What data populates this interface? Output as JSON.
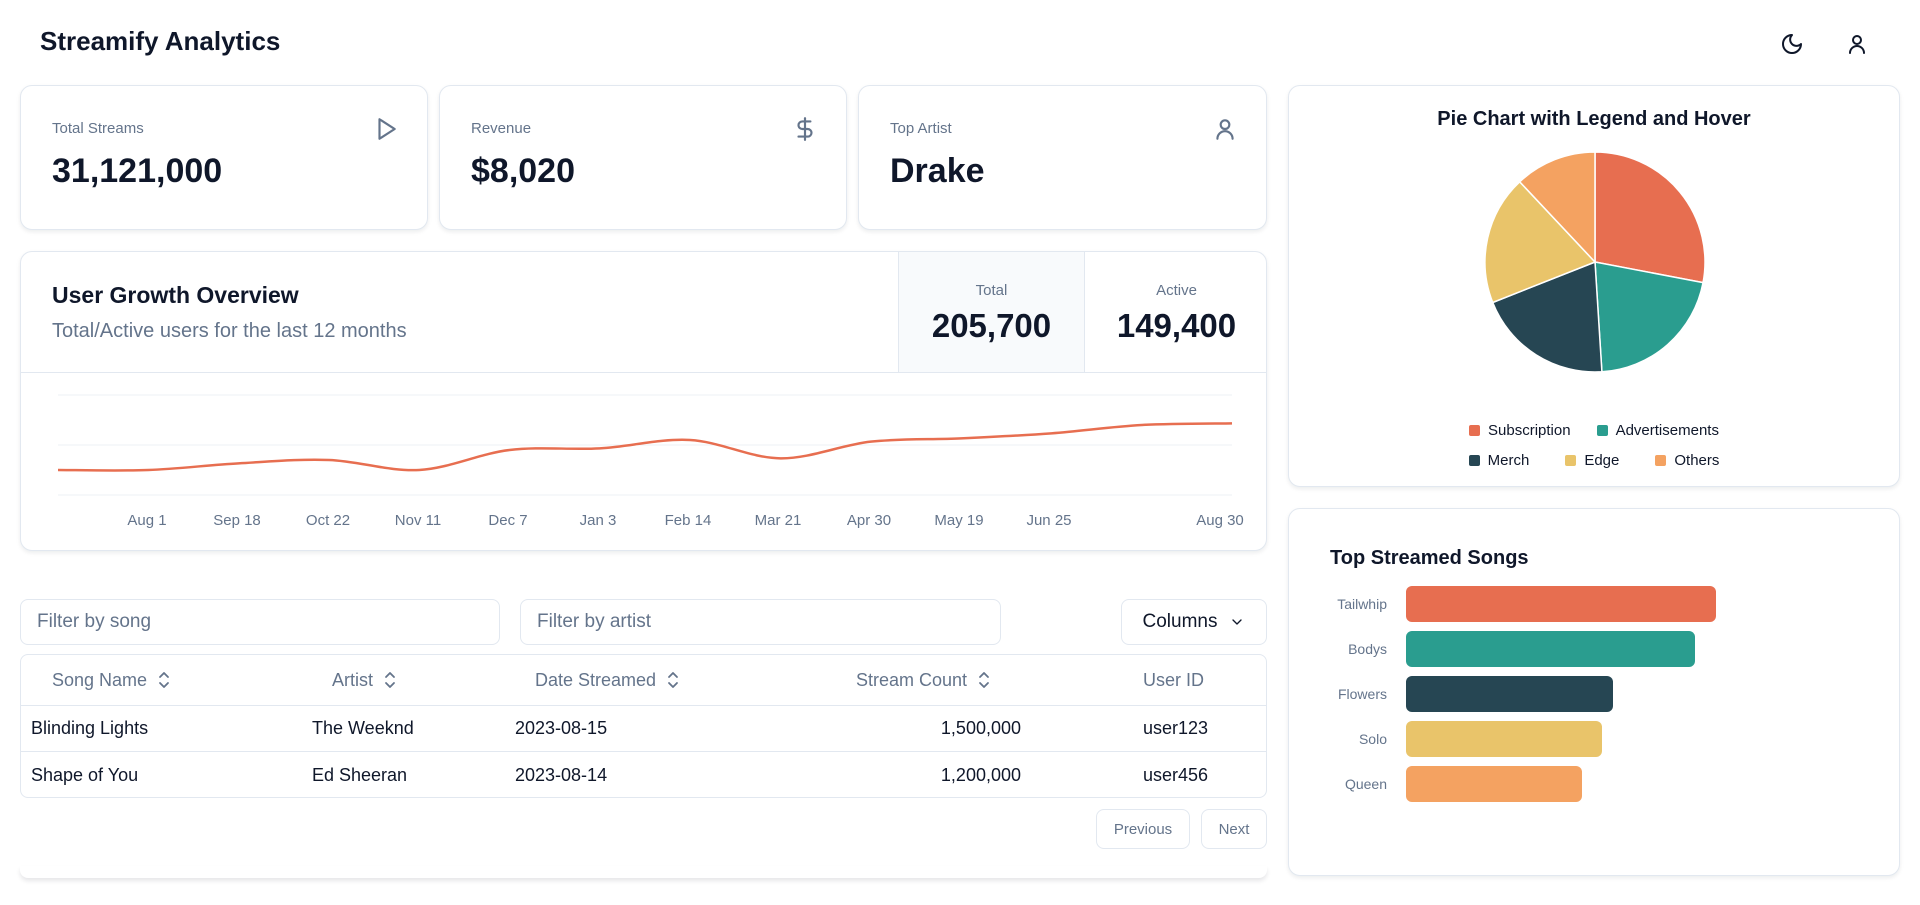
{
  "app": {
    "title": "Streamify Analytics"
  },
  "header": {
    "theme_icon": "moon-icon",
    "user_icon": "user-icon"
  },
  "stats": [
    {
      "label": "Total Streams",
      "value": "31,121,000",
      "icon": "play-icon"
    },
    {
      "label": "Revenue",
      "value": "$8,020",
      "icon": "dollar-icon"
    },
    {
      "label": "Top Artist",
      "value": "Drake",
      "icon": "user-icon"
    }
  ],
  "growth": {
    "title": "User Growth Overview",
    "subtitle": "Total/Active users for the last 12 months",
    "total_label": "Total",
    "total_value": "205,700",
    "active_label": "Active",
    "active_value": "149,400",
    "line_color": "#e76e50"
  },
  "filters": {
    "song_placeholder": "Filter by song",
    "artist_placeholder": "Filter by artist",
    "columns_label": "Columns"
  },
  "table": {
    "headers": [
      "Song Name",
      "Artist",
      "Date Streamed",
      "Stream Count",
      "User ID"
    ],
    "rows": [
      [
        "Blinding Lights",
        "The Weeknd",
        "2023-08-15",
        "1,500,000",
        "user123"
      ],
      [
        "Shape of You",
        "Ed Sheeran",
        "2023-08-14",
        "1,200,000",
        "user456"
      ]
    ]
  },
  "pagination": {
    "previous_label": "Previous",
    "next_label": "Next"
  },
  "pie": {
    "title": "Pie Chart with Legend and Hover"
  },
  "songs": {
    "title": "Top Streamed Songs"
  },
  "chart_data": [
    {
      "type": "line",
      "x": [
        "Aug 1",
        "Sep 18",
        "Oct 22",
        "Nov 11",
        "Dec 7",
        "Jan 3",
        "Feb 14",
        "Mar 21",
        "Apr 30",
        "May 19",
        "Jun 25",
        "Aug 30"
      ],
      "series": [
        {
          "values": [
            45,
            45,
            49,
            51,
            45,
            57,
            58,
            63,
            52,
            62,
            64,
            67,
            72,
            73
          ]
        }
      ],
      "grid": true
    },
    {
      "type": "pie",
      "title": "Pie Chart with Legend and Hover",
      "labels": [
        "Subscription",
        "Advertisements",
        "Merch",
        "Edge",
        "Others"
      ],
      "values": [
        28,
        21,
        20,
        19,
        12
      ],
      "colors": [
        "#e76e50",
        "#2a9d8f",
        "#264653",
        "#e9c46a",
        "#f4a261"
      ],
      "legend": "bottom"
    },
    {
      "type": "bar",
      "orientation": "horizontal",
      "title": "Top Streamed Songs",
      "categories": [
        "Tailwhip",
        "Bodys",
        "Flowers",
        "Solo",
        "Queen"
      ],
      "values": [
        310,
        289,
        207,
        196,
        176
      ],
      "colors": [
        "#e76e50",
        "#2a9d8f",
        "#264653",
        "#e9c46a",
        "#f4a261"
      ]
    }
  ]
}
